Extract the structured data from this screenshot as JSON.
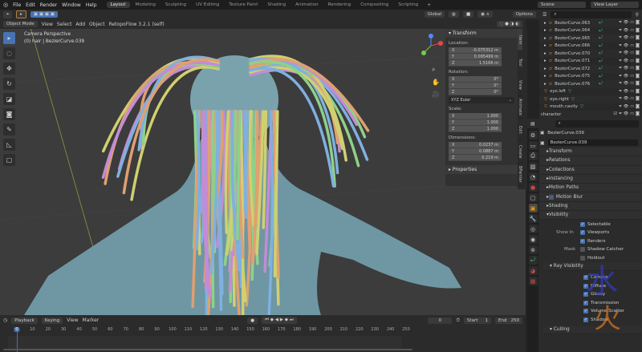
{
  "menu": {
    "items": [
      "File",
      "Edit",
      "Render",
      "Window",
      "Help"
    ],
    "workspaces": [
      "Layout",
      "Modeling",
      "Sculpting",
      "UV Editing",
      "Texture Paint",
      "Shading",
      "Animation",
      "Rendering",
      "Compositing",
      "Scripting"
    ],
    "active": "Layout",
    "scene": "Scene",
    "view_layer": "View Layer"
  },
  "tool_header": {
    "orientation": "Global",
    "options": "Options"
  },
  "viewport_header": {
    "mode": "Object Mode",
    "menus": [
      "View",
      "Select",
      "Add",
      "Object"
    ],
    "addon": "RetopoFlow 3.2.1 (self)"
  },
  "overlay": {
    "line1": "Camera Perspective",
    "line2": "(0) hair | BezierCurve.039"
  },
  "npanel": {
    "title": "Transform",
    "location_label": "Location:",
    "location": [
      {
        "axis": "X",
        "value": "-0.075312 m"
      },
      {
        "axis": "Y",
        "value": "0.095499 m"
      },
      {
        "axis": "Z",
        "value": "1.5166 m"
      }
    ],
    "rotation_label": "Rotation:",
    "rotation": [
      {
        "axis": "X",
        "value": "0°"
      },
      {
        "axis": "Y",
        "value": "0°"
      },
      {
        "axis": "Z",
        "value": "0°"
      }
    ],
    "rotation_mode": "XYZ Euler",
    "scale_label": "Scale:",
    "scale": [
      {
        "axis": "X",
        "value": "1.000"
      },
      {
        "axis": "Y",
        "value": "1.000"
      },
      {
        "axis": "Z",
        "value": "1.000"
      }
    ],
    "dimensions_label": "Dimensions:",
    "dimensions": [
      {
        "axis": "X",
        "value": "0.0237 m"
      },
      {
        "axis": "Y",
        "value": "0.0887 m"
      },
      {
        "axis": "Z",
        "value": "0.219 m"
      }
    ],
    "properties": "Properties",
    "tabs": [
      "Item",
      "Tool",
      "View",
      "Animate",
      "Edit",
      "Create",
      "BPainter"
    ]
  },
  "outliner": {
    "rows": [
      "BezierCurve.063",
      "BezierCurve.064",
      "BezierCurve.065",
      "BezierCurve.066",
      "BezierCurve.070",
      "BezierCurve.071",
      "BezierCurve.072",
      "BezierCurve.075",
      "BezierCurve.076"
    ],
    "meshes": [
      "eye.left",
      "eye.right",
      "mouth.cavity"
    ],
    "collection": "character"
  },
  "properties": {
    "object_name": "BezierCurve.039",
    "name_field": "BezierCurve.039",
    "sections": [
      "Transform",
      "Relations",
      "Collections",
      "Instancing",
      "Motion Paths",
      "Motion Blur",
      "Shading",
      "Visibility"
    ],
    "selectable": "Selectable",
    "show_in": "Show In",
    "viewports": "Viewports",
    "renders": "Renders",
    "mask": "Mask",
    "shadow_catcher": "Shadow Catcher",
    "holdout": "Holdout",
    "ray_visibility": "Ray Visibility",
    "rays": [
      "Camera",
      "Diffuse",
      "Glossy",
      "Transmission",
      "Volume Scatter",
      "Shadow"
    ],
    "culling": "Culling"
  },
  "timeline": {
    "menus": [
      "Playback",
      "Keying",
      "View",
      "Marker"
    ],
    "current_frame": "0",
    "start_label": "Start",
    "start": "1",
    "end_label": "End",
    "end": "250",
    "ticks": [
      "0",
      "10",
      "20",
      "30",
      "40",
      "50",
      "60",
      "70",
      "80",
      "90",
      "100",
      "110",
      "120",
      "130",
      "140",
      "150",
      "160",
      "170",
      "180",
      "190",
      "200",
      "210",
      "220",
      "230",
      "240",
      "250"
    ]
  },
  "colors": {
    "accent": "#4772b3",
    "body": "#6e97a3",
    "hair": [
      "#c48bd6",
      "#8fd08a",
      "#e0a070",
      "#7fb0e0",
      "#d0d070"
    ]
  }
}
